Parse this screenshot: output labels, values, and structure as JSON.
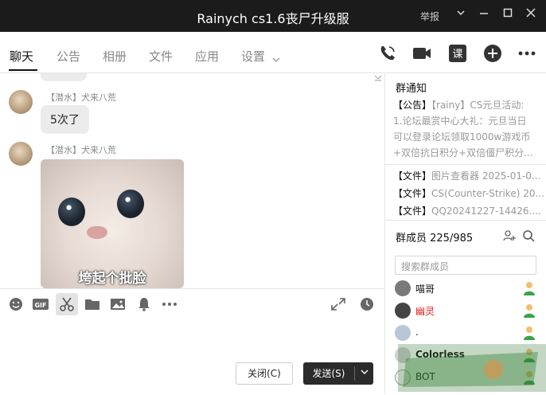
{
  "window": {
    "title": "Rainych cs1.6丧尸升级服",
    "report_label": "举报"
  },
  "tabs": [
    {
      "label": "聊天",
      "active": true
    },
    {
      "label": "公告"
    },
    {
      "label": "相册"
    },
    {
      "label": "文件"
    },
    {
      "label": "应用"
    },
    {
      "label": "设置"
    }
  ],
  "messages": [
    {
      "sender": "【潜水】犬来八荒",
      "text": "5次了"
    },
    {
      "sender": "【潜水】犬来八荒",
      "sticker_caption": "垮起个批脸"
    }
  ],
  "footer": {
    "close_label": "关闭(C)",
    "send_label": "发送(S)"
  },
  "notice": {
    "title": "群通知",
    "announcement_tag": "【公告】",
    "announcement_text": "【rainy】CS元旦活动:\n1.论坛最赏中心大礼：元旦当日\n可以登录论坛领取1000w游戏币\n+双倍抗日积分+双倍僵尸积分..."
  },
  "files": [
    {
      "tag": "【文件】",
      "name": "图片查看器 2025-01-0..."
    },
    {
      "tag": "【文件】",
      "name": "CS(Counter-Strike) 20..."
    },
    {
      "tag": "【文件】",
      "name": "QQ20241227-14426...."
    }
  ],
  "members": {
    "title": "群成员 225/985",
    "search_placeholder": "搜索群成员",
    "list": [
      {
        "name": "喵哥",
        "color": "#111111"
      },
      {
        "name": "幽灵",
        "color": "#e02020"
      },
      {
        "name": ".",
        "color": "#111111"
      },
      {
        "name": "Colorless",
        "color": "#111111"
      },
      {
        "name": "BOT",
        "color": "#111111"
      }
    ]
  },
  "colors": {
    "titlebar": "#1b1b1b",
    "send_button": "#2b2b2b",
    "member_role_green": "#3aa34a"
  }
}
